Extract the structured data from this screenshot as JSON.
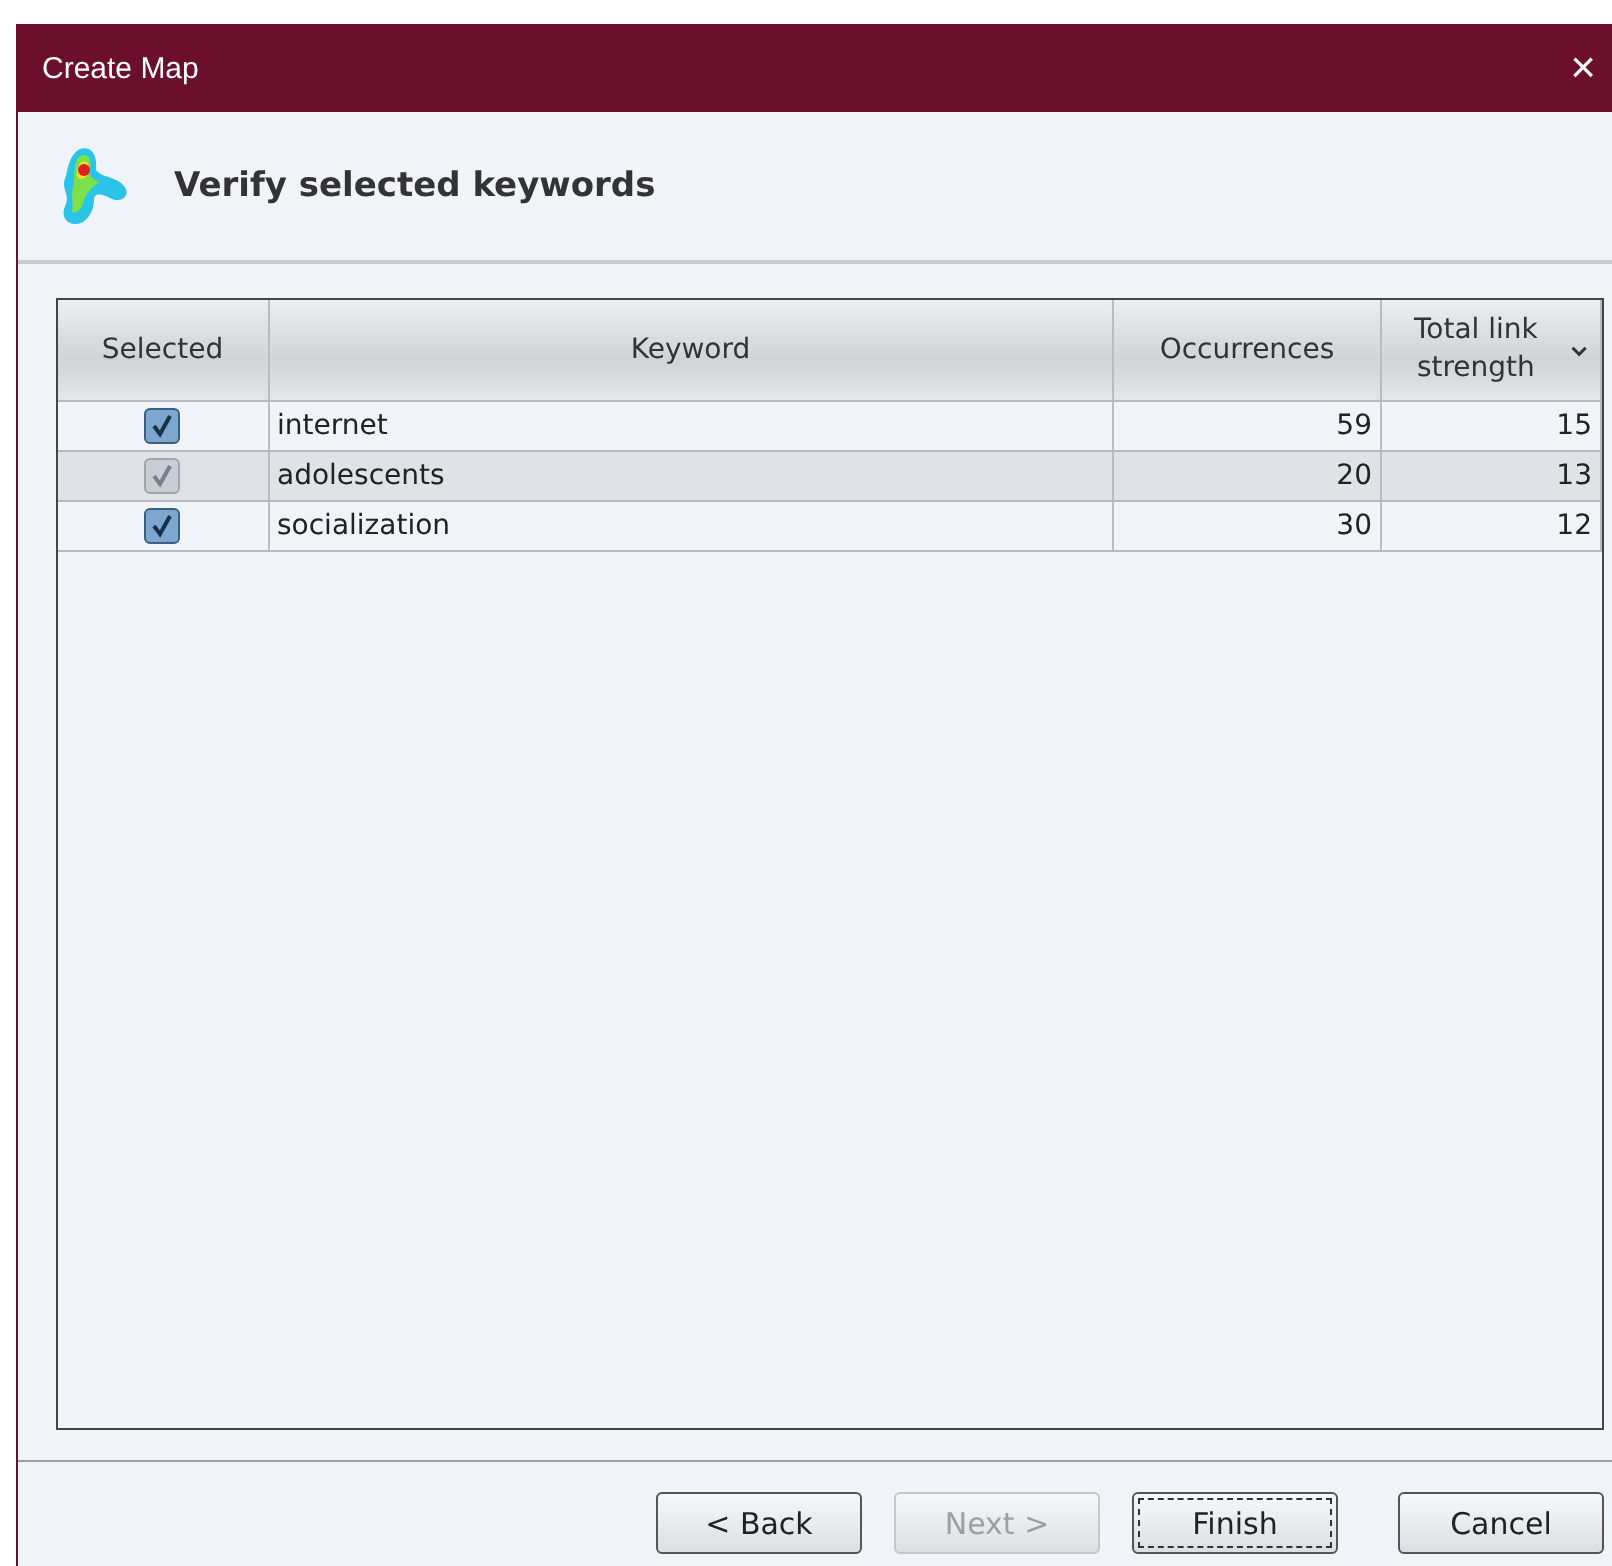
{
  "window": {
    "title": "Create Map",
    "close": "×"
  },
  "header": {
    "title": "Verify selected keywords"
  },
  "table": {
    "columns": [
      {
        "label": "Selected",
        "sorted": false
      },
      {
        "label": "Keyword",
        "sorted": false
      },
      {
        "label": "Occurrences",
        "sorted": false
      },
      {
        "label": "Total link strength",
        "sorted": true
      }
    ],
    "rows": [
      {
        "checked": true,
        "selected": false,
        "keyword": "internet",
        "occurrences": "59",
        "strength": "15"
      },
      {
        "checked": true,
        "selected": true,
        "keyword": "adolescents",
        "occurrences": "20",
        "strength": "13"
      },
      {
        "checked": true,
        "selected": false,
        "keyword": "socialization",
        "occurrences": "30",
        "strength": "12"
      }
    ]
  },
  "buttons": [
    {
      "label": "< Back",
      "disabled": false,
      "focused": false
    },
    {
      "label": "Next >",
      "disabled": true,
      "focused": false
    },
    {
      "label": "Finish",
      "disabled": false,
      "focused": true
    },
    {
      "label": "Cancel",
      "disabled": false,
      "focused": false
    }
  ]
}
